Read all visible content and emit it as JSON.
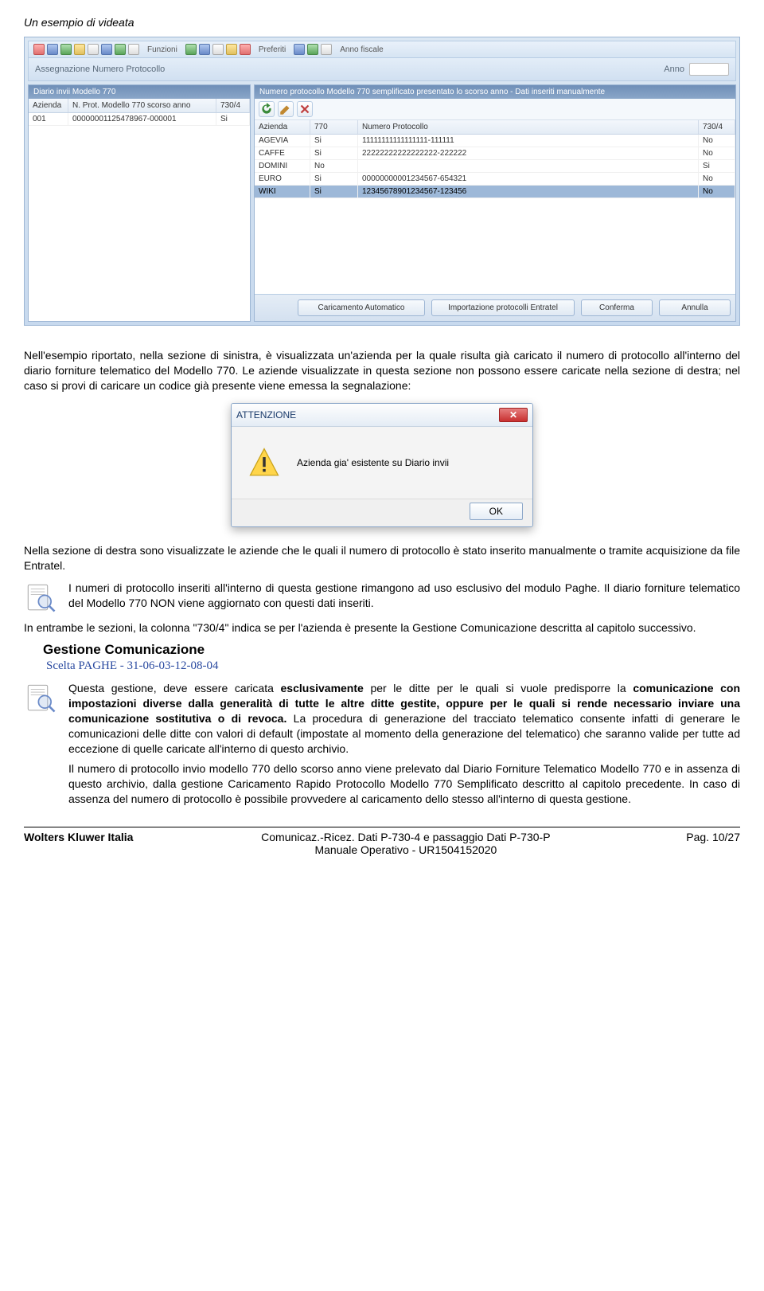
{
  "title": "Un esempio di videata",
  "app": {
    "toolbar_labels": {
      "funzioni": "Funzioni",
      "preferiti": "Preferiti",
      "anno_fiscale": "Anno fiscale"
    },
    "subtitle": "Assegnazione Numero Protocollo",
    "anno_label": "Anno",
    "left_panel": {
      "title": "Diario invii Modello 770",
      "headers": {
        "azienda": "Azienda",
        "nprot": "N. Prot. Modello 770 scorso anno",
        "c7304": "730/4"
      },
      "rows": [
        {
          "azienda": "001",
          "nprot": "00000001125478967-000001",
          "c7304": "Si"
        }
      ]
    },
    "right_panel": {
      "title": "Numero protocollo Modello 770 semplificato presentato lo scorso anno - Dati inseriti manualmente",
      "headers": {
        "azienda": "Azienda",
        "c770": "770",
        "numprot": "Numero Protocollo",
        "c7304": "730/4"
      },
      "rows": [
        {
          "azienda": "AGEVIA",
          "c770": "Si",
          "numprot": "11111111111111111-111111",
          "c7304": "No"
        },
        {
          "azienda": "CAFFE",
          "c770": "Si",
          "numprot": "22222222222222222-222222",
          "c7304": "No"
        },
        {
          "azienda": "DOMINI",
          "c770": "No",
          "numprot": "",
          "c7304": "Si"
        },
        {
          "azienda": "EURO",
          "c770": "Si",
          "numprot": "00000000001234567-654321",
          "c7304": "No"
        },
        {
          "azienda": "WIKI",
          "c770": "Si",
          "numprot": "12345678901234567-123456",
          "c7304": "No"
        }
      ]
    },
    "buttons": {
      "car_auto": "Caricamento Automatico",
      "import_ent": "Importazione protocolli Entratel",
      "conferma": "Conferma",
      "annulla": "Annulla"
    }
  },
  "para1": "Nell'esempio riportato, nella sezione di sinistra, è visualizzata un'azienda per la quale risulta già caricato il numero di protocollo all'interno del diario forniture telematico del Modello 770. Le aziende visualizzate in questa sezione non possono essere caricate nella sezione di destra; nel caso si provi di caricare un codice già presente viene emessa la segnalazione:",
  "dialog": {
    "title": "ATTENZIONE",
    "message": "Azienda gia' esistente su Diario invii",
    "ok": "OK"
  },
  "para2": "Nella sezione di destra sono visualizzate le aziende che le quali il numero di protocollo è stato inserito manualmente o tramite acquisizione da file Entratel.",
  "note1": "I numeri di protocollo inseriti all'interno di questa gestione rimangono ad uso esclusivo del modulo Paghe. Il diario forniture telematico del Modello 770 NON viene aggiornato con questi dati inseriti.",
  "para3": "In entrambe le sezioni, la colonna \"730/4\" indica se per l'azienda è presente la Gestione Comunicazione descritta al capitolo successivo.",
  "section_heading": "Gestione Comunicazione",
  "blue_link": "Scelta PAGHE - 31-06-03-12-08-04",
  "note2_p1a": "Questa gestione, deve essere caricata ",
  "note2_p1b": "esclusivamente",
  "note2_p1c": " per le ditte per le quali si vuole predisporre la ",
  "note2_p1d": "comunicazione con impostazioni diverse dalla generalità di tutte le altre ditte gestite, oppure per le quali si rende necessario inviare una comunicazione sostitutiva o di revoca.",
  "note2_p1e": " La procedura di generazione del tracciato telematico consente infatti di generare le comunicazioni delle ditte con valori di default (impostate al momento della generazione del telematico) che saranno valide per tutte ad eccezione di quelle caricate all'interno di questo archivio.",
  "note2_p2": "Il numero di protocollo invio modello 770 dello scorso anno viene prelevato dal Diario Forniture Telematico Modello 770 e in assenza di questo archivio, dalla gestione Caricamento Rapido Protocollo Modello 770 Semplificato descritto al capitolo precedente. In caso di assenza del numero di protocollo è possibile provvedere al caricamento dello stesso all'interno di questa gestione.",
  "footer": {
    "left": "Wolters Kluwer Italia",
    "center1": "Comunicaz.-Ricez. Dati P-730-4 e passaggio Dati P-730-P",
    "center2": "Manuale Operativo - UR1504152020",
    "right": "Pag. 10/27"
  }
}
